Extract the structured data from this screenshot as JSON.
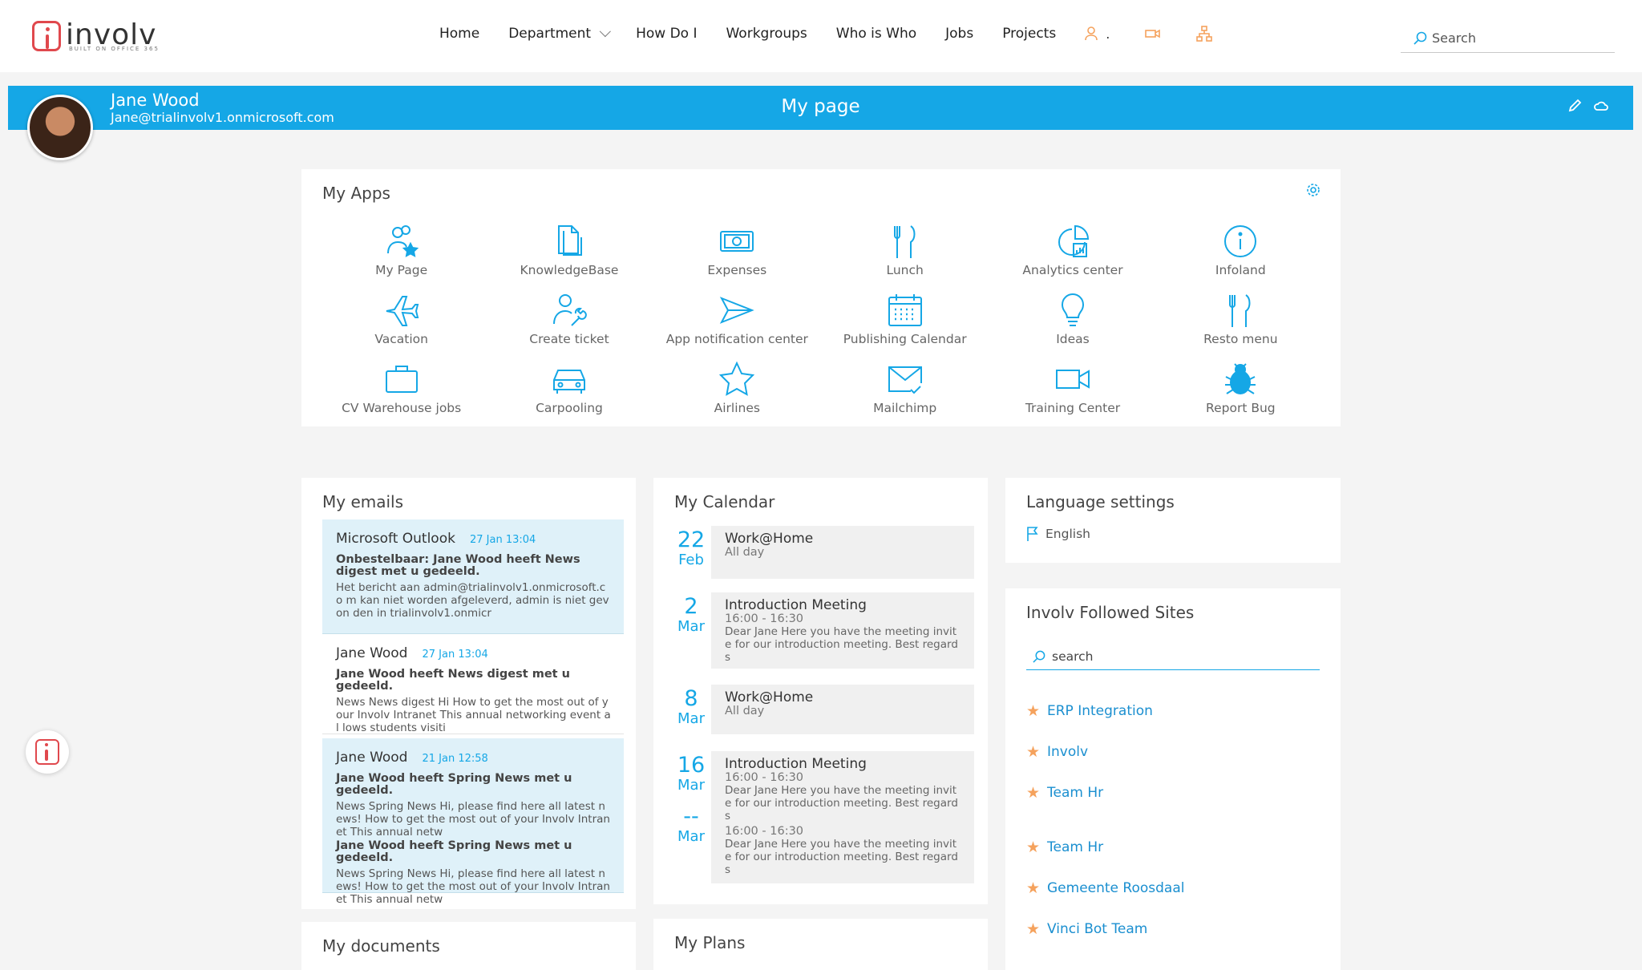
{
  "brand": {
    "name": "involv",
    "tagline": "BUILT ON OFFICE 365"
  },
  "nav": {
    "items": [
      "Home",
      "Department",
      "How Do I",
      "Workgroups",
      "Who is Who",
      "Jobs",
      "Projects"
    ],
    "icon_names": [
      "person-icon",
      "video-icon",
      "org-chart-icon"
    ],
    "icon_suffix": ".",
    "search_placeholder": "Search"
  },
  "banner": {
    "user_name": "Jane Wood",
    "user_email": "Jane@trialinvolv1.onmicrosoft.com",
    "title": "My page",
    "color": "#15a7e6"
  },
  "my_apps": {
    "title": "My Apps",
    "apps": [
      {
        "label": "My Page",
        "icon": "user-star-icon"
      },
      {
        "label": "KnowledgeBase",
        "icon": "documents-icon"
      },
      {
        "label": "Expenses",
        "icon": "money-icon"
      },
      {
        "label": "Lunch",
        "icon": "fork-knife-icon"
      },
      {
        "label": "Analytics center",
        "icon": "analytics-icon"
      },
      {
        "label": "Infoland",
        "icon": "info-icon"
      },
      {
        "label": "Vacation",
        "icon": "airplane-icon"
      },
      {
        "label": "Create ticket",
        "icon": "user-wrench-icon"
      },
      {
        "label": "App notification center",
        "icon": "paper-plane-icon"
      },
      {
        "label": "Publishing Calendar",
        "icon": "calendar-icon"
      },
      {
        "label": "Ideas",
        "icon": "lightbulb-icon"
      },
      {
        "label": "Resto menu",
        "icon": "fork-knife-icon"
      },
      {
        "label": "CV Warehouse jobs",
        "icon": "briefcase-icon"
      },
      {
        "label": "Carpooling",
        "icon": "car-icon"
      },
      {
        "label": "Airlines",
        "icon": "star-icon"
      },
      {
        "label": "Mailchimp",
        "icon": "mail-check-icon"
      },
      {
        "label": "Training Center",
        "icon": "video-camera-icon"
      },
      {
        "label": "Report Bug",
        "icon": "bug-icon"
      }
    ]
  },
  "emails": {
    "title": "My emails",
    "items": [
      {
        "from": "Microsoft Outlook",
        "date": "27   Jan   13:04",
        "highlight": true,
        "subjects": [
          "Onbestelbaar: Jane Wood heeft News digest met u gedeeld."
        ],
        "bodies": [
          "Het bericht aan admin@trialinvolv1.onmicrosoft.co m kan niet worden afgeleverd, admin is niet gevon den in trialinvolv1.onmicr"
        ]
      },
      {
        "from": "Jane Wood",
        "date": "27   Jan   13:04",
        "highlight": false,
        "subjects": [
          "Jane Wood heeft News digest met u gedeeld."
        ],
        "bodies": [
          "News News digest Hi How to get the most out of y our Involv Intranet This annual networking event al lows students visiti"
        ]
      },
      {
        "from": "Jane Wood",
        "date": "21   Jan   12:58",
        "highlight": true,
        "subjects": [
          "Jane Wood heeft Spring News met u gedeeld.",
          "Jane Wood heeft Spring News met u gedeeld."
        ],
        "bodies": [
          "News Spring News Hi, please find here all latest n ews! How to get the most out of your Involv Intran et This annual netw",
          "News Spring News Hi, please find here all latest n ews! How to get the most out of your Involv Intran et This annual netw"
        ]
      }
    ]
  },
  "documents": {
    "title": "My documents"
  },
  "calendar": {
    "title": "My Calendar",
    "events": [
      {
        "day": "22",
        "month": "Feb",
        "title": "Work@Home",
        "time": "All day",
        "body": ""
      },
      {
        "day": "2",
        "month": "Mar",
        "title": "Introduction Meeting",
        "time": "16:00 - 16:30",
        "body": "Dear Jane Here you have the meeting invit e for our introduction meeting. Best regard s"
      },
      {
        "day": "8",
        "month": "Mar",
        "title": "Work@Home",
        "time": "All day",
        "body": ""
      },
      {
        "day": "16",
        "month": "Mar",
        "title": "Introduction Meeting",
        "time": "16:00 - 16:30",
        "body": "Dear Jane Here you have the meeting invit e for our introduction meeting. Best regard s"
      },
      {
        "day": "--",
        "month": "Mar",
        "title": "",
        "time": "16:00 - 16:30",
        "body": "Dear Jane Here you have the meeting invit e for our introduction meeting. Best regard s"
      }
    ]
  },
  "plans": {
    "title": "My Plans"
  },
  "language": {
    "title": "Language settings",
    "value": "English"
  },
  "followed": {
    "title": "Involv Followed Sites",
    "search_placeholder": "search",
    "sites": [
      "ERP Integration",
      "Involv",
      "Team Hr",
      "Team Hr",
      "Gemeente Roosdaal",
      "Vinci Bot Team"
    ]
  }
}
